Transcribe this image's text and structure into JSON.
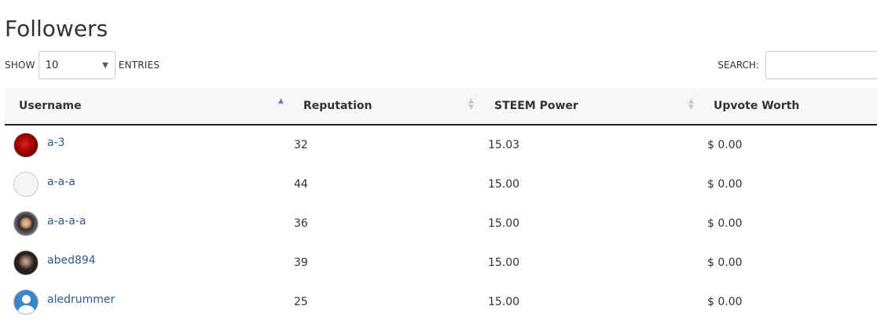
{
  "page": {
    "title": "Followers"
  },
  "length_control": {
    "show_label": "SHOW",
    "selected": "10",
    "entries_label": "ENTRIES"
  },
  "search": {
    "label": "SEARCH:",
    "value": ""
  },
  "table": {
    "headers": [
      "Username",
      "Reputation",
      "STEEM Power",
      "Upvote Worth"
    ],
    "sorted_column": "Username",
    "rows": [
      {
        "username": "a-3",
        "avatar": "rose-photo",
        "reputation": "32",
        "steem_power": "15.03",
        "upvote_worth": "$ 0.00"
      },
      {
        "username": "a-a-a",
        "avatar": "blank-avatar",
        "reputation": "44",
        "steem_power": "15.00",
        "upvote_worth": "$ 0.00"
      },
      {
        "username": "a-a-a-a",
        "avatar": "woman-photo",
        "reputation": "36",
        "steem_power": "15.00",
        "upvote_worth": "$ 0.00"
      },
      {
        "username": "abed894",
        "avatar": "man-photo",
        "reputation": "39",
        "steem_power": "15.00",
        "upvote_worth": "$ 0.00"
      },
      {
        "username": "aledrummer",
        "avatar": "default-user-icon",
        "reputation": "25",
        "steem_power": "15.00",
        "upvote_worth": "$ 0.00"
      }
    ]
  },
  "colors": {
    "link": "#2f5a8a",
    "header_bg": "#f7f7f7",
    "sort_active": "#7a7aa8"
  }
}
